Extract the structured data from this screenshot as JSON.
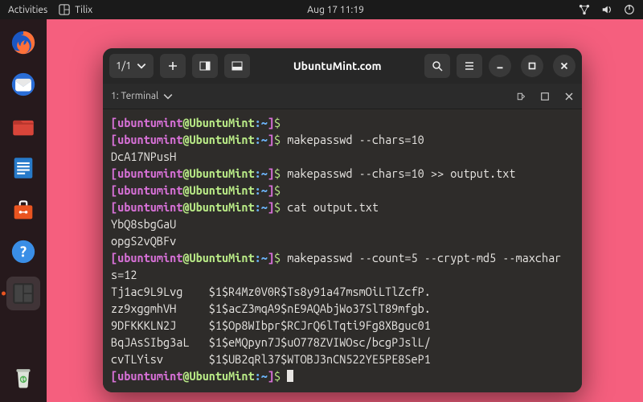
{
  "topbar": {
    "activities": "Activities",
    "appname": "Tilix",
    "datetime": "Aug 17  11:19"
  },
  "dock": {
    "items": [
      {
        "name": "firefox"
      },
      {
        "name": "thunderbird"
      },
      {
        "name": "files"
      },
      {
        "name": "writer"
      },
      {
        "name": "software"
      },
      {
        "name": "help"
      },
      {
        "name": "tilix",
        "active": true
      },
      {
        "name": "trash"
      }
    ]
  },
  "window": {
    "sessionLabel": "1/1",
    "title": "UbuntuMint.com",
    "tabLabel": "1: Terminal"
  },
  "prompt": {
    "open": "[",
    "user": "ubuntumint",
    "at": "@",
    "host": "UbuntuMint",
    "colon": ":",
    "path": "~",
    "close": "]",
    "sym": "$"
  },
  "lines": [
    {
      "t": "prompt",
      "cmd": ""
    },
    {
      "t": "prompt",
      "cmd": "makepasswd --chars=10"
    },
    {
      "t": "out",
      "text": "DcA17NPusH"
    },
    {
      "t": "prompt",
      "cmd": "makepasswd --chars=10 >> output.txt"
    },
    {
      "t": "prompt",
      "cmd": ""
    },
    {
      "t": "prompt",
      "cmd": "cat output.txt"
    },
    {
      "t": "out",
      "text": "YbQ8sbgGaU"
    },
    {
      "t": "out",
      "text": "opgS2vQBFv"
    },
    {
      "t": "prompt",
      "cmd": "makepasswd --count=5 --crypt-md5 --maxchar"
    },
    {
      "t": "out",
      "text": "s=12"
    },
    {
      "t": "out",
      "text": "Tj1ac9L9Lvg    $1$R4Mz0V0R$Ts8y91a47msmOiLTlZcfP."
    },
    {
      "t": "out",
      "text": "zz9xggmhVH     $1$acZ3mqA9$nE9AQAbjWo37SlT89mfgb."
    },
    {
      "t": "out",
      "text": "9DFKKKLN2J     $1$Op8WIbpr$RCJrQ6lTqti9Fg8XBguc01"
    },
    {
      "t": "out",
      "text": "BqJAsSIbg3aL   $1$eMQpyn7J$uO778ZVIWOsc/bcgPJslL/"
    },
    {
      "t": "out",
      "text": "cvTLYisv       $1$UB2qRl37$WTOBJ3nCN522YE5PE8SeP1"
    },
    {
      "t": "prompt",
      "cmd": "",
      "cursor": true
    }
  ]
}
